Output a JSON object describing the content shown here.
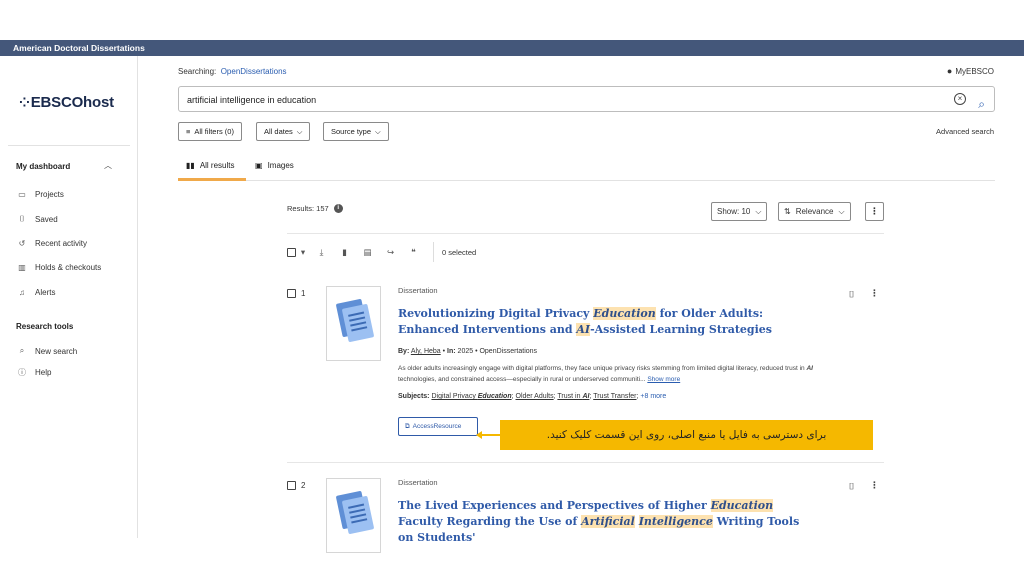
{
  "topbar": {
    "title": "American Doctoral Dissertations"
  },
  "sidebar": {
    "logo": "EBSCOhost",
    "dashboard_label": "My dashboard",
    "items": [
      {
        "label": "Projects",
        "icon": "folder-icon"
      },
      {
        "label": "Saved",
        "icon": "bookmark-icon"
      },
      {
        "label": "Recent activity",
        "icon": "history-icon"
      },
      {
        "label": "Holds & checkouts",
        "icon": "library-icon"
      },
      {
        "label": "Alerts",
        "icon": "bell-icon"
      }
    ],
    "research_tools_label": "Research tools",
    "tools": [
      {
        "label": "New search",
        "icon": "search-icon"
      },
      {
        "label": "Help",
        "icon": "help-icon"
      }
    ]
  },
  "header": {
    "searching_label": "Searching:",
    "database": "OpenDissertations",
    "myebsco": "MyEBSCO",
    "query": "artificial intelligence in education",
    "filters": {
      "all_filters": "All filters (0)",
      "all_dates": "All dates",
      "source_type": "Source type"
    },
    "advanced_search": "Advanced search"
  },
  "tabs": [
    {
      "label": "All results",
      "active": true
    },
    {
      "label": "Images",
      "active": false
    }
  ],
  "results": {
    "count_label": "Results: 157",
    "show_label": "Show: 10",
    "sort_label": "Relevance",
    "selected_label": "0 selected"
  },
  "records": [
    {
      "number": "1",
      "type": "Dissertation",
      "title_a": "Revolutionizing Digital Privacy ",
      "title_hl1": "Education",
      "title_b": " for Older Adults: Enhanced Interventions and ",
      "title_hl2": "AI",
      "title_c": "-Assisted Learning Strategies",
      "by_label": "By:",
      "author": "Aly, Heba",
      "in_label": "In:",
      "year_source": "2025 • OpenDissertations",
      "abstract_a": "As older adults increasingly engage with digital platforms, they face unique privacy risks stemming from limited digital literacy, reduced trust in ",
      "abstract_hl": "AI",
      "abstract_b": " technologies, and constrained access—especially in rural or underserved communiti...",
      "show_more": "Show more",
      "subjects_label": "Subjects:",
      "subject1_a": "Digital Privacy ",
      "subject1_hl": "Education",
      "subject2": "Older Adults",
      "subject3_a": "Trust in ",
      "subject3_hl": "AI",
      "subject4": "Trust Transfer",
      "more_subjects": "+8 more",
      "access_label": "AccessResource"
    },
    {
      "number": "2",
      "type": "Dissertation",
      "title_a": "The Lived Experiences and Perspectives of Higher ",
      "title_hl1": "Education",
      "title_b": " Faculty Regarding the Use of ",
      "title_hl2": "Artificial",
      "title_c": " ",
      "title_hl3": "Intelligence",
      "title_d": " Writing Tools on Students'"
    }
  ],
  "callout": {
    "text": "برای دسترسی به فایل یا منبع اصلی، روی این قسمت کلیک کنید.",
    "color": "#f5b800"
  },
  "colors": {
    "topbar": "#44577a",
    "link": "#2f5aa8",
    "highlight": "#fde2b0",
    "tab_underline": "#f0a94a"
  }
}
